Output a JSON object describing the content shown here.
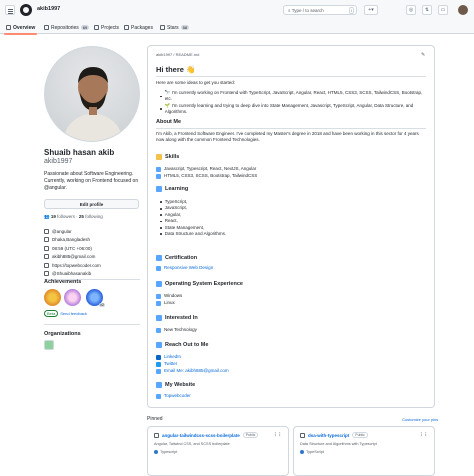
{
  "header": {
    "username": "akib1997",
    "search_placeholder": "Type / to search",
    "search_key": "/",
    "icons": [
      "plus-icon",
      "issues-icon",
      "pull-requests-icon",
      "inbox-icon"
    ]
  },
  "tabs": [
    {
      "label": "Overview",
      "count": ""
    },
    {
      "label": "Repositories",
      "count": "69"
    },
    {
      "label": "Projects",
      "count": ""
    },
    {
      "label": "Packages",
      "count": ""
    },
    {
      "label": "Stars",
      "count": "58"
    }
  ],
  "profile": {
    "name": "Shuaib hasan akib",
    "login": "akib1997",
    "bio": "Passionate about Software Engineering. Currently, working on Frontend focused on @angular.",
    "edit_label": "Edit profile",
    "followers_count": "19",
    "followers_label": "followers",
    "following_count": "25",
    "following_label": "following",
    "vcard": [
      {
        "icon": "people-icon",
        "text": "@angular"
      },
      {
        "icon": "location-icon",
        "text": "Dhaka,Bangladesh"
      },
      {
        "icon": "clock-icon",
        "text": "08:59 (UTC +06:00)"
      },
      {
        "icon": "mail-icon",
        "text": "akibh885@gmail.com"
      },
      {
        "icon": "link-icon",
        "text": "https://topwebcoder.com"
      },
      {
        "icon": "twitter-icon",
        "text": "@Shuaibhasanakib"
      }
    ]
  },
  "achievements": {
    "heading": "Achievements",
    "beta_badge": "Beta",
    "feedback": "Send feedback",
    "badge_counts": [
      "",
      "",
      "x2"
    ]
  },
  "organizations": {
    "heading": "Organizations"
  },
  "readme": {
    "path": "akib1997 / README.md",
    "title": "Hi there 👋",
    "intro": "Here are some ideas to get you started:",
    "bullets": [
      "🔭 I'm currently working on Frontend with TypeScript, JavaScript, Angular, React, HTML5, CSS3, SCSS, TailwindCSS, Bootstrap, etc.",
      "🌱 I'm currently learning and trying to deep dive into State Management, Javascript, TypeScript, Angular, Data Structure, and Algorithms."
    ],
    "about_heading": "About Me",
    "about_text": "I'm Akib, a Frontend Software Engineer. I've completed my Master's degree in 2018 and have been working in this sector for 4 years now along with the common Frontend Technologies.",
    "skills_heading": "Skills",
    "skills": [
      "Javascript, Typescript, React, NextJS, Angular",
      "HTML5, CSS3, SCSS, Bootstrap, TailwindCSS"
    ],
    "learning_heading": "Learning",
    "learning": [
      "TypeScript,",
      "JavaScript,",
      "Angular,",
      "React,",
      "State Management,",
      "Data Structure and Algorithms."
    ],
    "cert_heading": "Certification",
    "cert": "Responsive Web Design",
    "os_heading": "Operating System Experience",
    "os": [
      "Windows",
      "Linux"
    ],
    "interested_heading": "Interested In",
    "interested": "New Technology",
    "reach_heading": "Reach Out to Me",
    "reach": [
      "LinkedIn",
      "Twitter",
      "Email Me: akibh885@gmail.com"
    ],
    "website_heading": "My Website",
    "website": "Topwebcoder"
  },
  "pinned": {
    "heading": "Pinned",
    "customize": "Customize your pins",
    "cards": [
      {
        "title": "angular-tailwindcss-scss-boilerplate",
        "visibility": "Public",
        "desc": "Angular, Tailwind CSS, and SCSS boilerplate",
        "lang": "Typescript"
      },
      {
        "title": "dsa-with-typescript",
        "visibility": "Public",
        "desc": "Data Structure and Algorithms with Typescript",
        "lang": "TypeScript"
      }
    ]
  },
  "colors": {
    "accent": "#0969da",
    "tab_underline": "#fd8c73",
    "typescript": "#3178c6"
  }
}
